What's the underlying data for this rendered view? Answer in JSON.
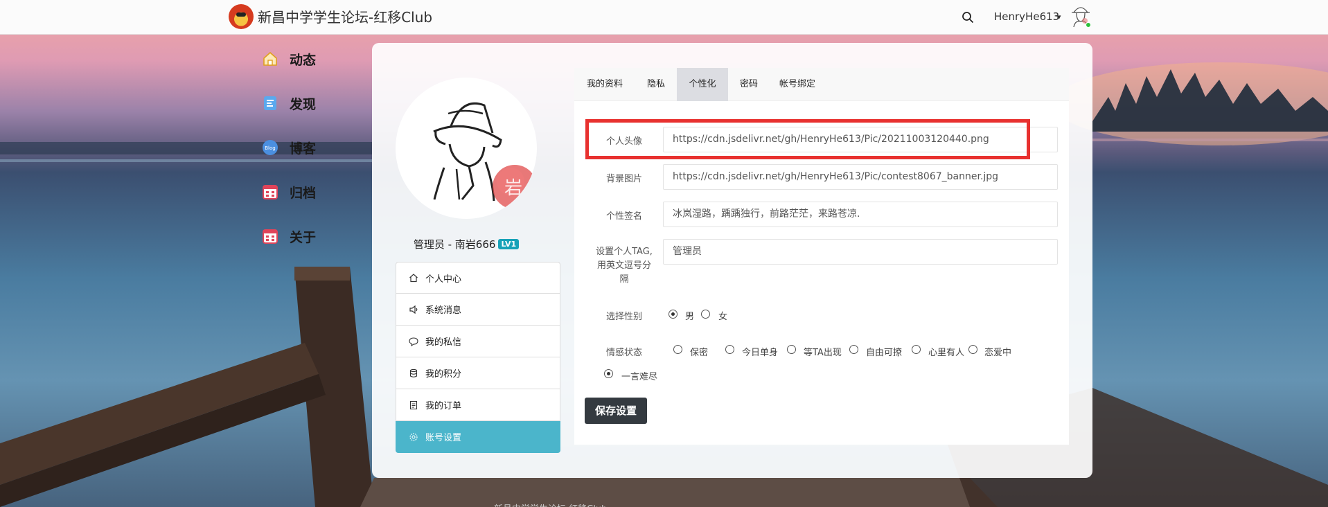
{
  "navbar": {
    "site_title": "新昌中学学生论坛-红移Club",
    "username": "HenryHe613",
    "caret": "▾"
  },
  "left_menu": [
    {
      "label": "动态",
      "icon": "home-icon"
    },
    {
      "label": "发现",
      "icon": "discover-icon"
    },
    {
      "label": "博客",
      "icon": "blog-icon"
    },
    {
      "label": "归档",
      "icon": "archive-icon"
    },
    {
      "label": "关于",
      "icon": "about-icon"
    }
  ],
  "profile": {
    "user_line": "管理员 - 南岩666",
    "level": "LV1"
  },
  "side_nav": [
    {
      "label": "个人中心",
      "icon": "home-icon"
    },
    {
      "label": "系统消息",
      "icon": "speaker-icon"
    },
    {
      "label": "我的私信",
      "icon": "chat-icon"
    },
    {
      "label": "我的积分",
      "icon": "database-icon"
    },
    {
      "label": "我的订单",
      "icon": "document-icon"
    },
    {
      "label": "账号设置",
      "icon": "gear-icon",
      "active": true
    }
  ],
  "tabs": [
    {
      "label": "我的资料"
    },
    {
      "label": "隐私"
    },
    {
      "label": "个性化",
      "active": true
    },
    {
      "label": "密码"
    },
    {
      "label": "帐号绑定"
    }
  ],
  "form": {
    "avatar_label": "个人头像",
    "avatar_value": "https://cdn.jsdelivr.net/gh/HenryHe613/Pic/20211003120440.png",
    "bg_label": "背景图片",
    "bg_value": "https://cdn.jsdelivr.net/gh/HenryHe613/Pic/contest8067_banner.jpg",
    "sign_label": "个性签名",
    "sign_value": "冰岚湿路，踽踽独行，前路茫茫，来路苍凉.",
    "tag_label_1": "设置个人TAG,",
    "tag_label_2": "用英文逗号分",
    "tag_label_3": "隔",
    "tag_value": "管理员",
    "gender_label": "选择性别",
    "gender_options": [
      "男",
      "女"
    ],
    "gender_selected": "男",
    "emotion_label": "情感状态",
    "emotion_options": [
      "保密",
      "今日单身",
      "等TA出现",
      "自由可撩",
      "心里有人",
      "恋爱中",
      "一言难尽"
    ],
    "emotion_selected": "一言难尽",
    "save_label": "保存设置"
  },
  "footer": {
    "text": "新昌中学学生论坛 红移Club"
  },
  "colors": {
    "accent": "#4bb5cb",
    "highlight": "#e8312f",
    "save_button": "#343a40",
    "badge": "#17a2b8"
  }
}
